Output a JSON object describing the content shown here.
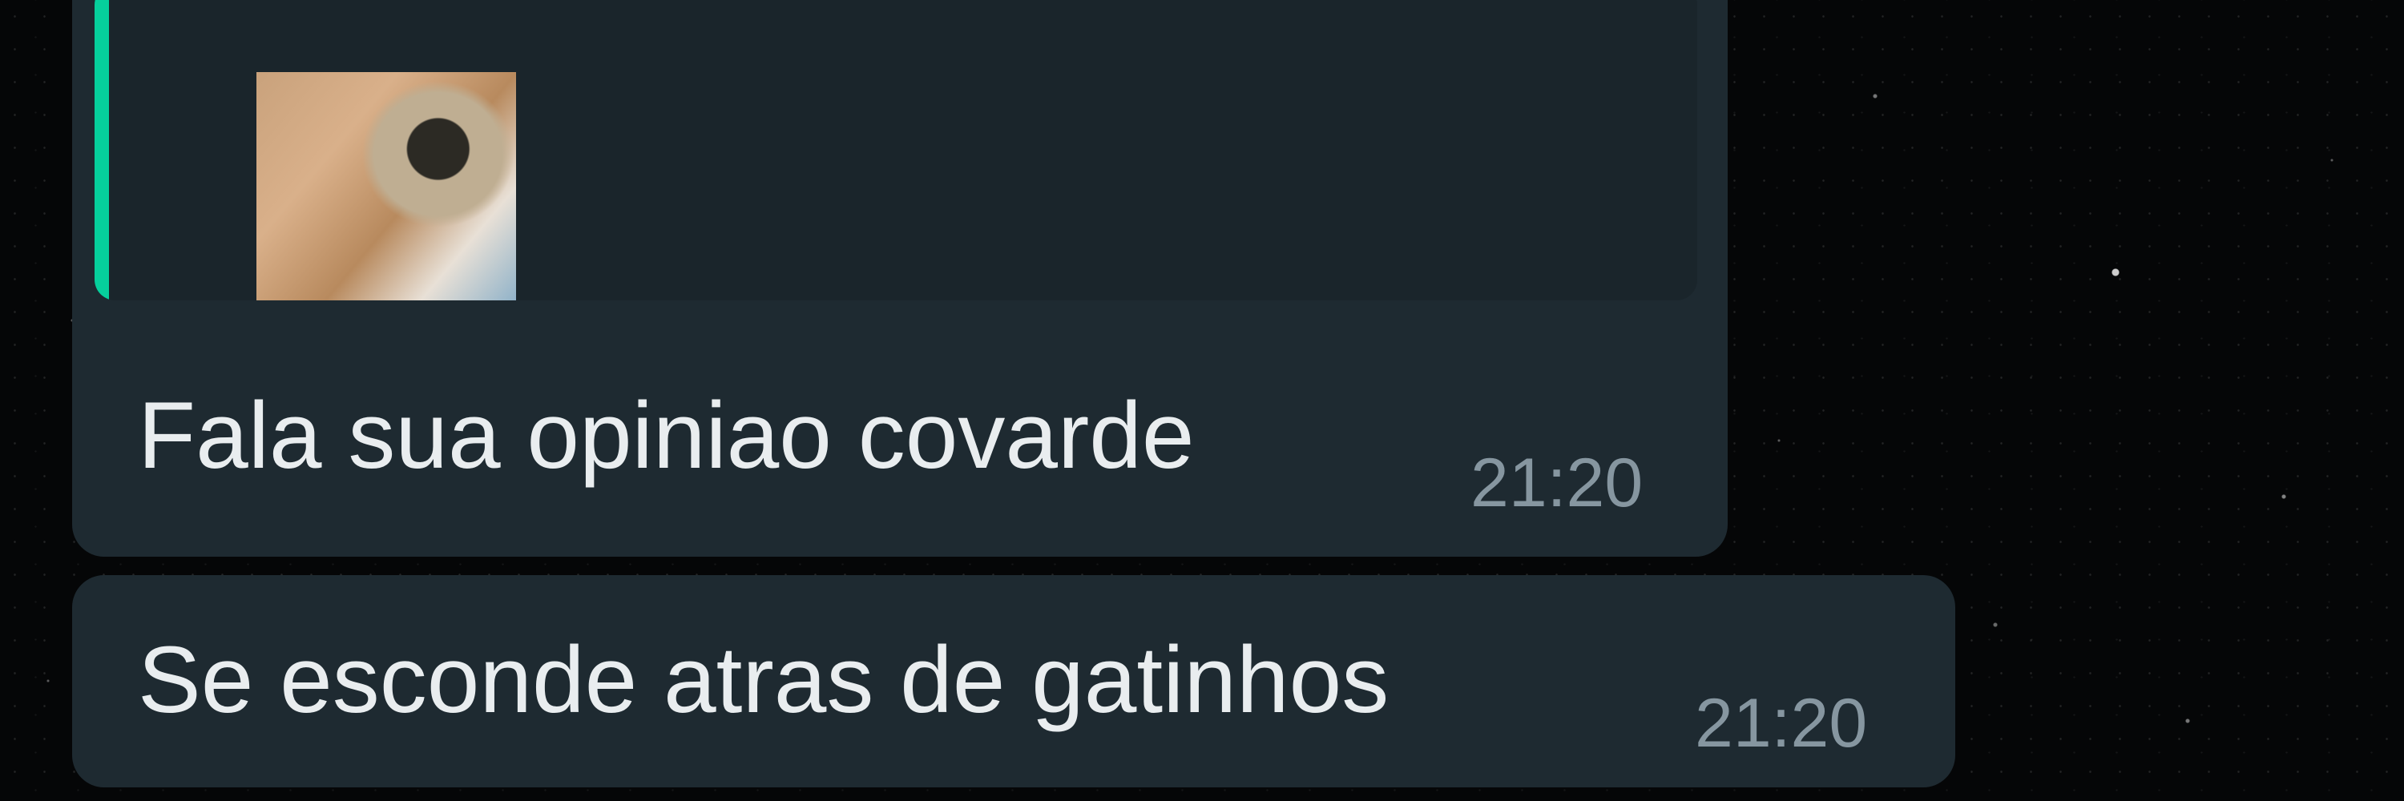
{
  "chat": {
    "messages": [
      {
        "type": "reply",
        "text": "Fala sua opiniao covarde",
        "time": "21:20",
        "quoted_thumbnail_icon": "cat-photo-thumbnail"
      },
      {
        "type": "text",
        "text": "Se esconde atras de gatinhos",
        "time": "21:20"
      }
    ]
  },
  "colors": {
    "bubble": "#1e2a31",
    "quote_background": "#1a252b",
    "quote_accent": "#06cf9c",
    "message_text": "#e9edef",
    "timestamp": "#8696a0",
    "wallpaper": "#050607"
  }
}
